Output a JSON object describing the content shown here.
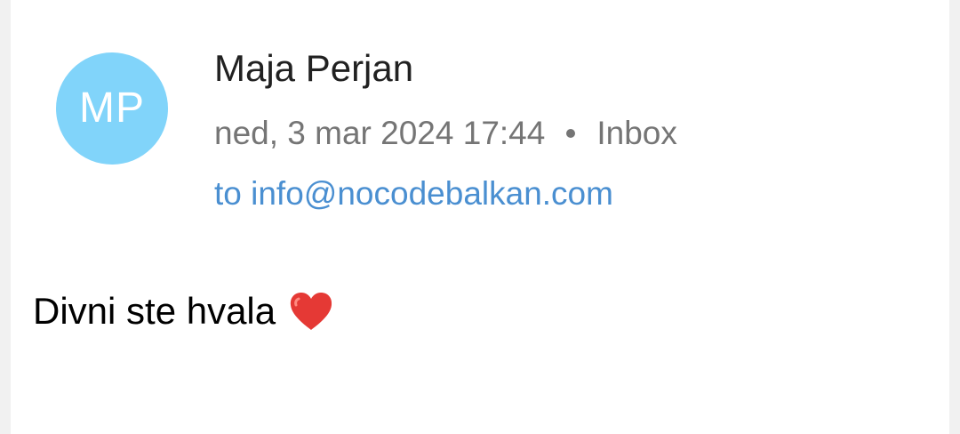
{
  "sender": {
    "initials": "MP",
    "name": "Maja Perjan",
    "avatar_color": "#81d4fa"
  },
  "meta": {
    "date": "ned, 3 mar 2024 17:44",
    "separator": "•",
    "folder": "Inbox"
  },
  "recipient": {
    "text": "to info@nocodebalkan.com"
  },
  "message": {
    "body": "Divni ste hvala",
    "emoji_icon": "red-heart-icon"
  },
  "colors": {
    "link": "#4a8fd1",
    "heart": "#e53935"
  }
}
